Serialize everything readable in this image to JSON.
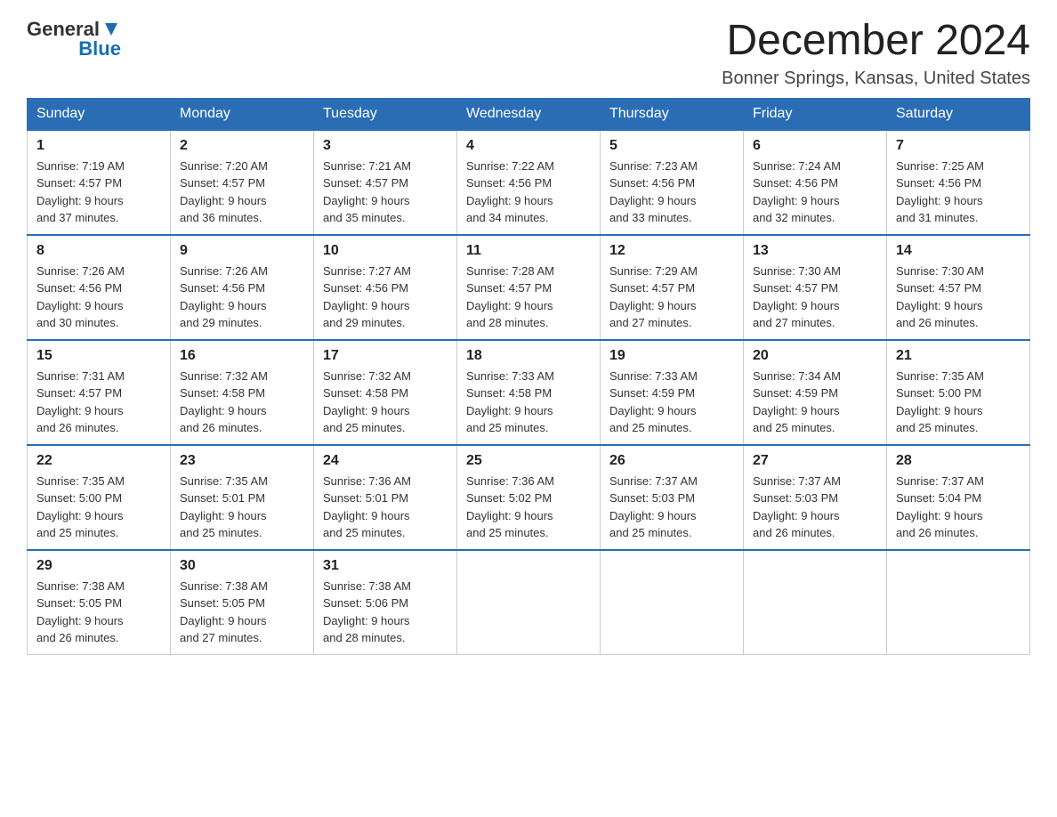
{
  "logo": {
    "general": "General",
    "blue": "Blue"
  },
  "header": {
    "month_year": "December 2024",
    "location": "Bonner Springs, Kansas, United States"
  },
  "days_of_week": [
    "Sunday",
    "Monday",
    "Tuesday",
    "Wednesday",
    "Thursday",
    "Friday",
    "Saturday"
  ],
  "weeks": [
    [
      {
        "day": "1",
        "sunrise": "7:19 AM",
        "sunset": "4:57 PM",
        "daylight": "9 hours and 37 minutes."
      },
      {
        "day": "2",
        "sunrise": "7:20 AM",
        "sunset": "4:57 PM",
        "daylight": "9 hours and 36 minutes."
      },
      {
        "day": "3",
        "sunrise": "7:21 AM",
        "sunset": "4:57 PM",
        "daylight": "9 hours and 35 minutes."
      },
      {
        "day": "4",
        "sunrise": "7:22 AM",
        "sunset": "4:56 PM",
        "daylight": "9 hours and 34 minutes."
      },
      {
        "day": "5",
        "sunrise": "7:23 AM",
        "sunset": "4:56 PM",
        "daylight": "9 hours and 33 minutes."
      },
      {
        "day": "6",
        "sunrise": "7:24 AM",
        "sunset": "4:56 PM",
        "daylight": "9 hours and 32 minutes."
      },
      {
        "day": "7",
        "sunrise": "7:25 AM",
        "sunset": "4:56 PM",
        "daylight": "9 hours and 31 minutes."
      }
    ],
    [
      {
        "day": "8",
        "sunrise": "7:26 AM",
        "sunset": "4:56 PM",
        "daylight": "9 hours and 30 minutes."
      },
      {
        "day": "9",
        "sunrise": "7:26 AM",
        "sunset": "4:56 PM",
        "daylight": "9 hours and 29 minutes."
      },
      {
        "day": "10",
        "sunrise": "7:27 AM",
        "sunset": "4:56 PM",
        "daylight": "9 hours and 29 minutes."
      },
      {
        "day": "11",
        "sunrise": "7:28 AM",
        "sunset": "4:57 PM",
        "daylight": "9 hours and 28 minutes."
      },
      {
        "day": "12",
        "sunrise": "7:29 AM",
        "sunset": "4:57 PM",
        "daylight": "9 hours and 27 minutes."
      },
      {
        "day": "13",
        "sunrise": "7:30 AM",
        "sunset": "4:57 PM",
        "daylight": "9 hours and 27 minutes."
      },
      {
        "day": "14",
        "sunrise": "7:30 AM",
        "sunset": "4:57 PM",
        "daylight": "9 hours and 26 minutes."
      }
    ],
    [
      {
        "day": "15",
        "sunrise": "7:31 AM",
        "sunset": "4:57 PM",
        "daylight": "9 hours and 26 minutes."
      },
      {
        "day": "16",
        "sunrise": "7:32 AM",
        "sunset": "4:58 PM",
        "daylight": "9 hours and 26 minutes."
      },
      {
        "day": "17",
        "sunrise": "7:32 AM",
        "sunset": "4:58 PM",
        "daylight": "9 hours and 25 minutes."
      },
      {
        "day": "18",
        "sunrise": "7:33 AM",
        "sunset": "4:58 PM",
        "daylight": "9 hours and 25 minutes."
      },
      {
        "day": "19",
        "sunrise": "7:33 AM",
        "sunset": "4:59 PM",
        "daylight": "9 hours and 25 minutes."
      },
      {
        "day": "20",
        "sunrise": "7:34 AM",
        "sunset": "4:59 PM",
        "daylight": "9 hours and 25 minutes."
      },
      {
        "day": "21",
        "sunrise": "7:35 AM",
        "sunset": "5:00 PM",
        "daylight": "9 hours and 25 minutes."
      }
    ],
    [
      {
        "day": "22",
        "sunrise": "7:35 AM",
        "sunset": "5:00 PM",
        "daylight": "9 hours and 25 minutes."
      },
      {
        "day": "23",
        "sunrise": "7:35 AM",
        "sunset": "5:01 PM",
        "daylight": "9 hours and 25 minutes."
      },
      {
        "day": "24",
        "sunrise": "7:36 AM",
        "sunset": "5:01 PM",
        "daylight": "9 hours and 25 minutes."
      },
      {
        "day": "25",
        "sunrise": "7:36 AM",
        "sunset": "5:02 PM",
        "daylight": "9 hours and 25 minutes."
      },
      {
        "day": "26",
        "sunrise": "7:37 AM",
        "sunset": "5:03 PM",
        "daylight": "9 hours and 25 minutes."
      },
      {
        "day": "27",
        "sunrise": "7:37 AM",
        "sunset": "5:03 PM",
        "daylight": "9 hours and 26 minutes."
      },
      {
        "day": "28",
        "sunrise": "7:37 AM",
        "sunset": "5:04 PM",
        "daylight": "9 hours and 26 minutes."
      }
    ],
    [
      {
        "day": "29",
        "sunrise": "7:38 AM",
        "sunset": "5:05 PM",
        "daylight": "9 hours and 26 minutes."
      },
      {
        "day": "30",
        "sunrise": "7:38 AM",
        "sunset": "5:05 PM",
        "daylight": "9 hours and 27 minutes."
      },
      {
        "day": "31",
        "sunrise": "7:38 AM",
        "sunset": "5:06 PM",
        "daylight": "9 hours and 28 minutes."
      },
      null,
      null,
      null,
      null
    ]
  ],
  "labels": {
    "sunrise": "Sunrise: ",
    "sunset": "Sunset: ",
    "daylight": "Daylight: "
  }
}
